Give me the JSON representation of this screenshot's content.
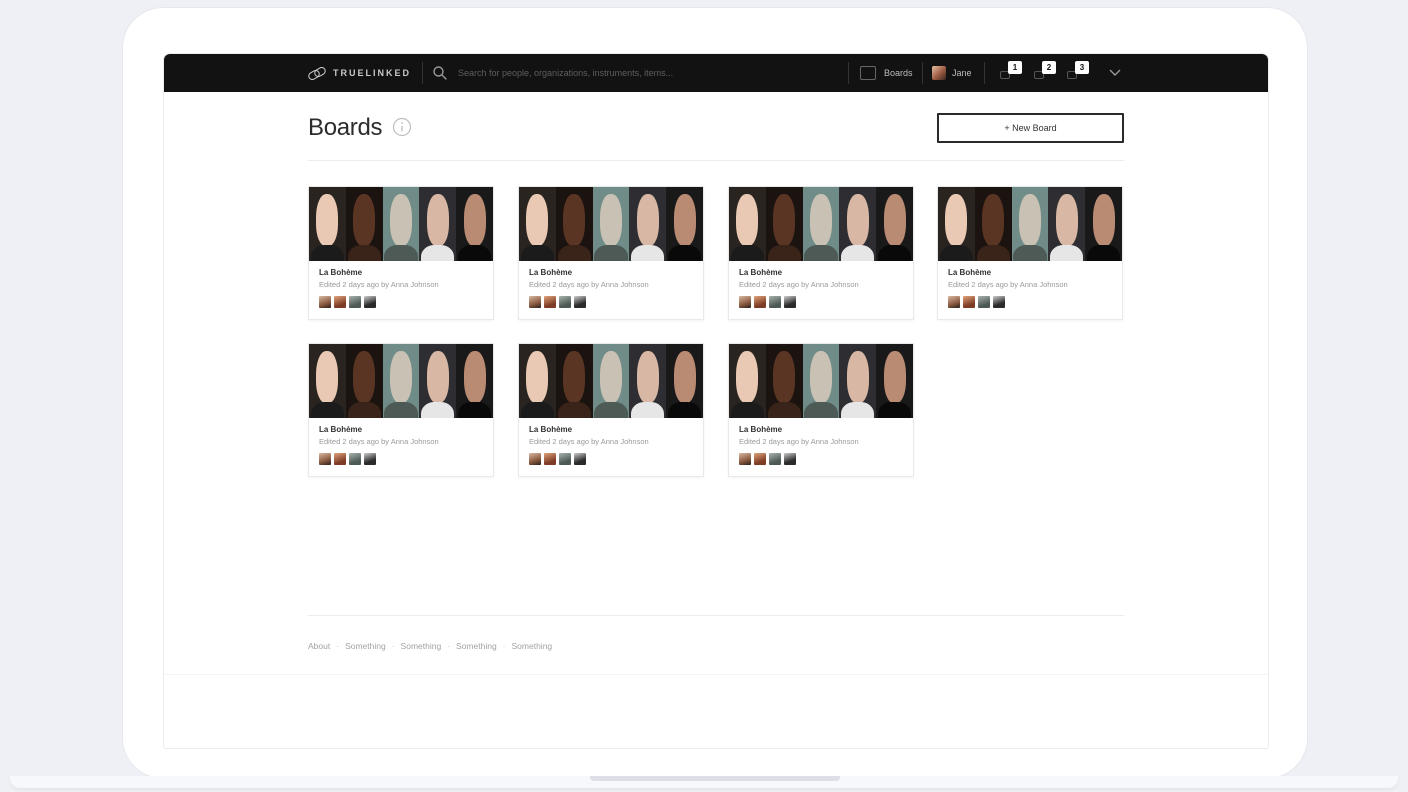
{
  "app": {
    "logo_text": "TRUELINKED",
    "logo_icon": "chain-link-icon"
  },
  "nav": {
    "search_placeholder": "Search for people, organizations, instruments, items...",
    "boards_label": "Boards",
    "user_name": "Jane",
    "notifications": [
      {
        "icon": "bell-icon",
        "count": "1"
      },
      {
        "icon": "message-icon",
        "count": "2"
      },
      {
        "icon": "chat-icon",
        "count": "3"
      }
    ],
    "menu_icon": "chevron-down-icon"
  },
  "page": {
    "title": "Boards",
    "info_icon": "info-icon",
    "new_board_label": "+ New Board"
  },
  "boards": [
    {
      "title": "La Bohème",
      "meta": "Edited 2 days ago by Anna Johnson"
    },
    {
      "title": "La Bohème",
      "meta": "Edited 2 days ago by Anna Johnson"
    },
    {
      "title": "La Bohème",
      "meta": "Edited 2 days ago by Anna Johnson"
    },
    {
      "title": "La Bohème",
      "meta": "Edited 2 days ago by Anna Johnson"
    },
    {
      "title": "La Bohème",
      "meta": "Edited 2 days ago by Anna Johnson"
    },
    {
      "title": "La Bohème",
      "meta": "Edited 2 days ago by Anna Johnson"
    },
    {
      "title": "La Bohème",
      "meta": "Edited 2 days ago by Anna Johnson"
    }
  ],
  "footer": {
    "links": [
      "About",
      "Something",
      "Something",
      "Something",
      "Something"
    ],
    "separator": "·"
  },
  "colors": {
    "nav_background": "#121212",
    "page_background": "#ffffff",
    "frame_background": "#eef0f5"
  }
}
